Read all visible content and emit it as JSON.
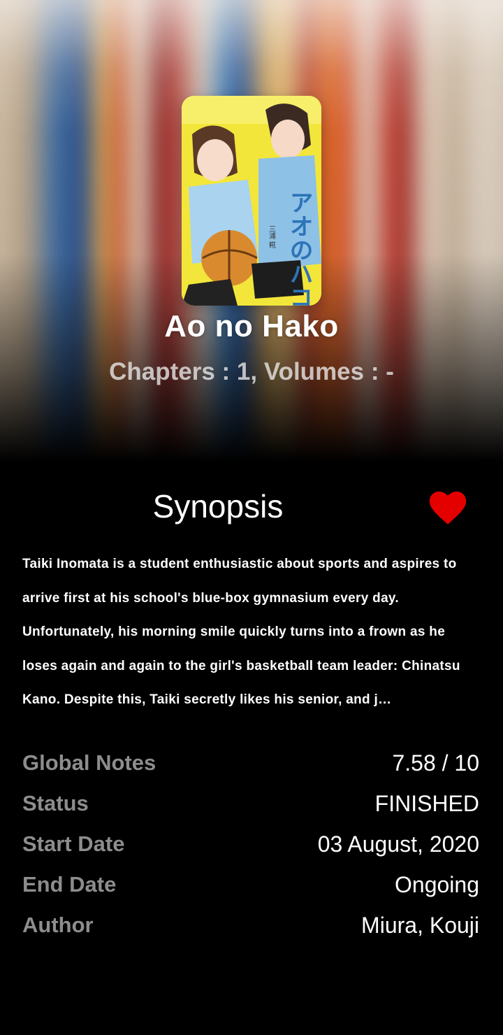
{
  "manga": {
    "title": "Ao no Hako",
    "subtitle": "Chapters : 1, Volumes : -",
    "cover_title_jp": "アオのハコ",
    "cover_author_jp": "三浦 糀"
  },
  "synopsis": {
    "heading": "Synopsis",
    "text": "Taiki Inomata is a student enthusiastic about sports and aspires to arrive first at his school's blue-box gymnasium every day. Unfortunately, his morning smile quickly turns into a frown as he loses again and again to the girl's basketball team leader: Chinatsu Kano. Despite this, Taiki secretly likes his senior, and j…",
    "favorite_icon": "heart-icon",
    "favorite_color": "#e50000"
  },
  "info": [
    {
      "label": "Global Notes",
      "value": "7.58 / 10"
    },
    {
      "label": "Status",
      "value": "FINISHED"
    },
    {
      "label": "Start Date",
      "value": "03 August, 2020"
    },
    {
      "label": "End Date",
      "value": "Ongoing"
    },
    {
      "label": "Author",
      "value": "Miura, Kouji"
    }
  ]
}
